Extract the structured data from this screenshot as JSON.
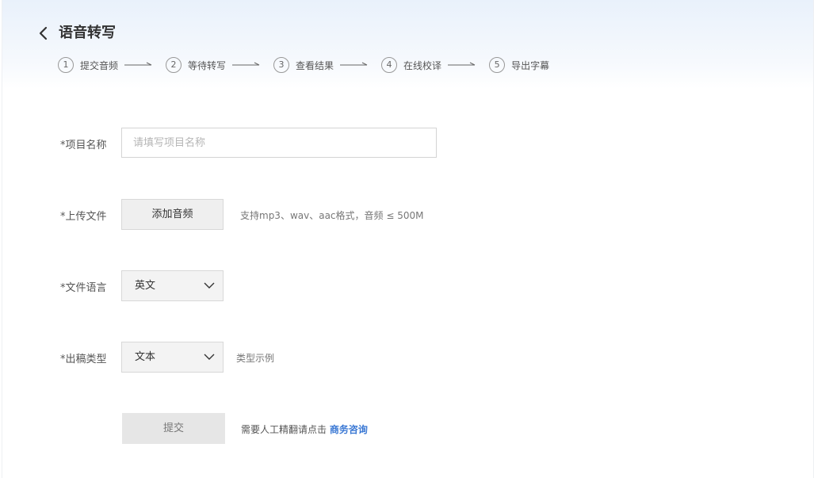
{
  "header": {
    "title": "语音转写",
    "steps": [
      {
        "num": "1",
        "label": "提交音频"
      },
      {
        "num": "2",
        "label": "等待转写"
      },
      {
        "num": "3",
        "label": "查看结果"
      },
      {
        "num": "4",
        "label": "在线校译"
      },
      {
        "num": "5",
        "label": "导出字幕"
      }
    ]
  },
  "form": {
    "project_name": {
      "label": "*项目名称",
      "value": "",
      "placeholder": "请填写项目名称"
    },
    "upload": {
      "label": "*上传文件",
      "button": "添加音频",
      "hint": "支持mp3、wav、aac格式，音频 ≤ 500M"
    },
    "language": {
      "label": "*文件语言",
      "value": "英文"
    },
    "output_type": {
      "label": "*出稿类型",
      "value": "文本",
      "example": "类型示例"
    },
    "submit": {
      "button": "提交",
      "note": "需要人工精翻请点击",
      "link": "商务咨询"
    }
  },
  "colors": {
    "link": "#3a78d4",
    "header_bg": "#e9f1fb"
  }
}
